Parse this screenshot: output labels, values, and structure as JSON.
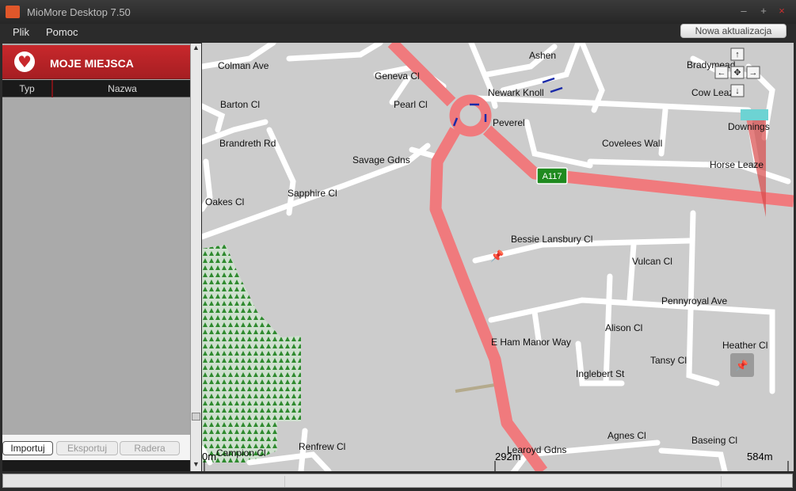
{
  "app": {
    "title": "MioMore Desktop 7.50",
    "update_button": "Nowa aktualizacja"
  },
  "window_controls": {
    "minimize": "–",
    "maximize": "+",
    "close": "×"
  },
  "menu": {
    "file": "Plik",
    "help": "Pomoc"
  },
  "places": {
    "title": "MOJE MIEJSCA",
    "heart_icon": "♥",
    "columns": {
      "type": "Typ",
      "name": "Nazwa"
    },
    "buttons": {
      "import": "Importuj",
      "export": "Eksportuj",
      "delete": "Radera"
    },
    "scroll_up": "▲",
    "scroll_down": "▼"
  },
  "map": {
    "streets": [
      "Colman Ave",
      "Geneva Cl",
      "Ashen",
      "Bradymead",
      "Barton Cl",
      "Pearl Cl",
      "Newark Knoll",
      "Cow Leaze",
      "Peverel",
      "Downings",
      "Brandreth Rd",
      "Covelees Wall",
      "Savage Gdns",
      "Horse Leaze",
      "Sapphire Cl",
      "Oakes Cl",
      "Bessie Lansbury Cl",
      "Vulcan Cl",
      "Pennyroyal Ave",
      "Alison Cl",
      "E Ham Manor Way",
      "Heather Cl",
      "Tansy Cl",
      "Inglebert St",
      "Agnes Cl",
      "Baseing Cl",
      "Renfrew Cl",
      "Campion Cl",
      "Learoyd Gdns"
    ],
    "road_shield": "A117",
    "scale": {
      "start": "0m",
      "mid": "292m",
      "end": "584m"
    },
    "nav": {
      "up": "↑",
      "down": "↓",
      "left": "←",
      "right": "→",
      "center": "✥"
    },
    "pin_icon": "📌"
  },
  "colors": {
    "accent": "#c8282c",
    "road_main": "#f07a7d",
    "road_shield": "#1f8a1f",
    "park": "#2e8a2e"
  }
}
